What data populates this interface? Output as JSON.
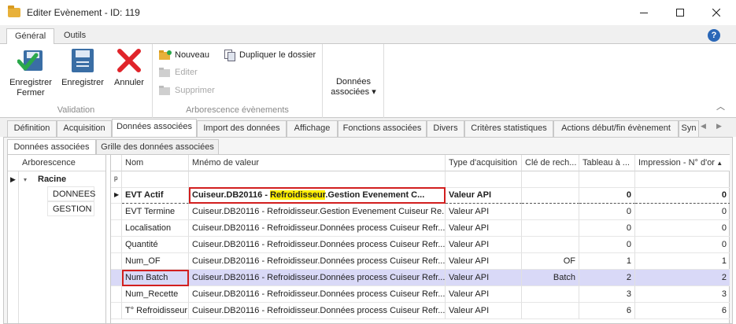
{
  "window": {
    "title": "Editer Evènement - ID: 119",
    "minimize_icon": "minimize-icon",
    "maximize_icon": "maximize-icon",
    "close_icon": "close-icon"
  },
  "ribbon_tabs": [
    {
      "label": "Général",
      "active": true
    },
    {
      "label": "Outils",
      "active": false
    }
  ],
  "ribbon": {
    "validation": {
      "caption": "Validation",
      "save_close": "Enregistrer\nFermer",
      "save": "Enregistrer",
      "cancel": "Annuler"
    },
    "tree": {
      "caption": "Arborescence évènements",
      "new": "Nouveau",
      "duplicate": "Dupliquer le dossier",
      "edit": "Editer",
      "delete": "Supprimer"
    },
    "linked": {
      "label": "Données\nassociées"
    }
  },
  "main_tabs": [
    {
      "label": "Définition"
    },
    {
      "label": "Acquisition"
    },
    {
      "label": "Données associées",
      "active": true
    },
    {
      "label": "Import des données"
    },
    {
      "label": "Affichage"
    },
    {
      "label": "Fonctions associées"
    },
    {
      "label": "Divers"
    },
    {
      "label": "Critères statistiques"
    },
    {
      "label": "Actions début/fin évènement"
    },
    {
      "label": "Syn"
    }
  ],
  "sub_tabs": [
    {
      "label": "Données associées",
      "active": true
    },
    {
      "label": "Grille des données associées"
    }
  ],
  "tree_panel": {
    "header": "Arborescence",
    "root": "Racine",
    "children": [
      "DONNEES",
      "GESTION"
    ]
  },
  "grid": {
    "columns": [
      "Nom",
      "Mnémo de valeur",
      "Type d'acquisition",
      "Clé de rech...",
      "Tableau à ...",
      "Impression - N° d'or"
    ],
    "rows": [
      {
        "nom": "EVT Actif",
        "mnemo_pre": "Cuiseur.DB20116 - ",
        "mnemo_hl": "Refroidisseur",
        "mnemo_post": ".Gestion Evenement C...",
        "type": "Valeur API",
        "cle": "",
        "tableau": "0",
        "impression": "0"
      },
      {
        "nom": "EVT Termine",
        "mnemo": "Cuiseur.DB20116 - Refroidisseur.Gestion Evenement Cuiseur Re...",
        "type": "Valeur API",
        "cle": "",
        "tableau": "0",
        "impression": "0"
      },
      {
        "nom": "Localisation",
        "mnemo": "Cuiseur.DB20116 - Refroidisseur.Données process Cuiseur Refr...",
        "type": "Valeur API",
        "cle": "",
        "tableau": "0",
        "impression": "0"
      },
      {
        "nom": "Quantité",
        "mnemo": "Cuiseur.DB20116 - Refroidisseur.Données process Cuiseur Refr...",
        "type": "Valeur API",
        "cle": "",
        "tableau": "0",
        "impression": "0"
      },
      {
        "nom": "Num_OF",
        "mnemo": "Cuiseur.DB20116 - Refroidisseur.Données process Cuiseur Refr...",
        "type": "Valeur API",
        "cle": "OF",
        "tableau": "1",
        "impression": "1"
      },
      {
        "nom": "Num Batch",
        "mnemo": "Cuiseur.DB20116 - Refroidisseur.Données process Cuiseur Refr...",
        "type": "Valeur API",
        "cle": "Batch",
        "tableau": "2",
        "impression": "2"
      },
      {
        "nom": "Num_Recette",
        "mnemo": "Cuiseur.DB20116 - Refroidisseur.Données process Cuiseur Refr...",
        "type": "Valeur API",
        "cle": "",
        "tableau": "3",
        "impression": "3"
      },
      {
        "nom": "T° Refroidisseur",
        "mnemo": "Cuiseur.DB20116 - Refroidisseur.Données process Cuiseur Refr...",
        "type": "Valeur API",
        "cle": "",
        "tableau": "6",
        "impression": "6"
      }
    ]
  }
}
